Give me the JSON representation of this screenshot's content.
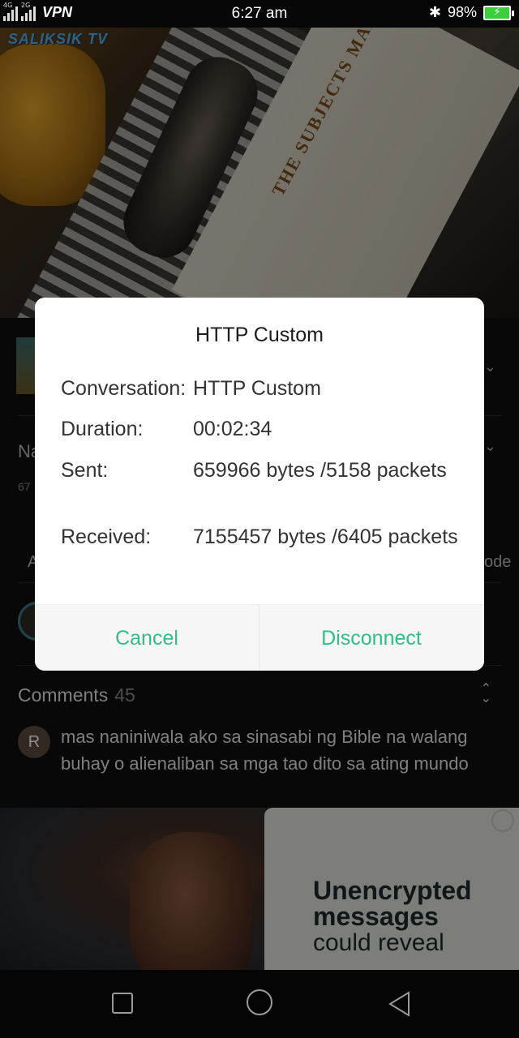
{
  "status_bar": {
    "network_top": "4G",
    "network_bottom": "2G",
    "vpn": "VPN",
    "time": "6:27 am",
    "battery": "98%"
  },
  "video": {
    "channel_logo": "SALIKSIK TV",
    "book_title": "THE SUBJECTS MANUAL"
  },
  "dialog": {
    "title": "HTTP Custom",
    "rows": [
      {
        "label": "Conversation:",
        "value": "HTTP Custom"
      },
      {
        "label": "Duration:",
        "value": "00:02:34"
      },
      {
        "label": "Sent:",
        "value": "659966 bytes /5158 packets"
      },
      {
        "label": "Received:",
        "value": "7155457 bytes /6405 packets"
      }
    ],
    "cancel": "Cancel",
    "disconnect": "Disconnect"
  },
  "page": {
    "title_fragment": "Na",
    "subtitle_fragment": "67",
    "action_fragment_left": "A",
    "action_fragment_right": "ode"
  },
  "comments": {
    "heading": "Comments",
    "count": "45",
    "first_comment": {
      "avatar_letter": "R",
      "text": "mas naniniwala ako sa sinasabi ng Bible na walang buhay o alienaliban sa mga tao dito sa ating mundo"
    }
  },
  "ad": {
    "line1": "Unencrypted",
    "line2": "messages",
    "line3": "could reveal"
  },
  "colors": {
    "accent": "#2dbf86",
    "battery": "#3ccf3c",
    "dialog_bg": "#ffffff",
    "ad_panel": "#e4e3dd"
  }
}
